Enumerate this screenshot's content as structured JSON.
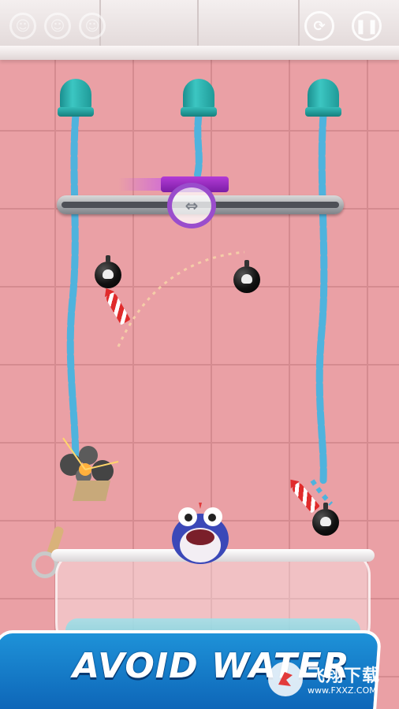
{
  "game": {
    "caption": "AVOID WATER"
  },
  "top_bar": {
    "left_icons": [
      "life-icon",
      "life-icon",
      "life-icon"
    ],
    "restart_icon": "restart-icon",
    "pause_icon": "pause-icon"
  },
  "colors": {
    "wall": "#eaa0a5",
    "water": "#4fb3dd",
    "pipe": "#2fb3b0",
    "gate": "#9a3fd0",
    "banner": "#1677c8"
  },
  "watermark": {
    "name": "飞翔下载",
    "url": "www.FXXZ.COM"
  }
}
